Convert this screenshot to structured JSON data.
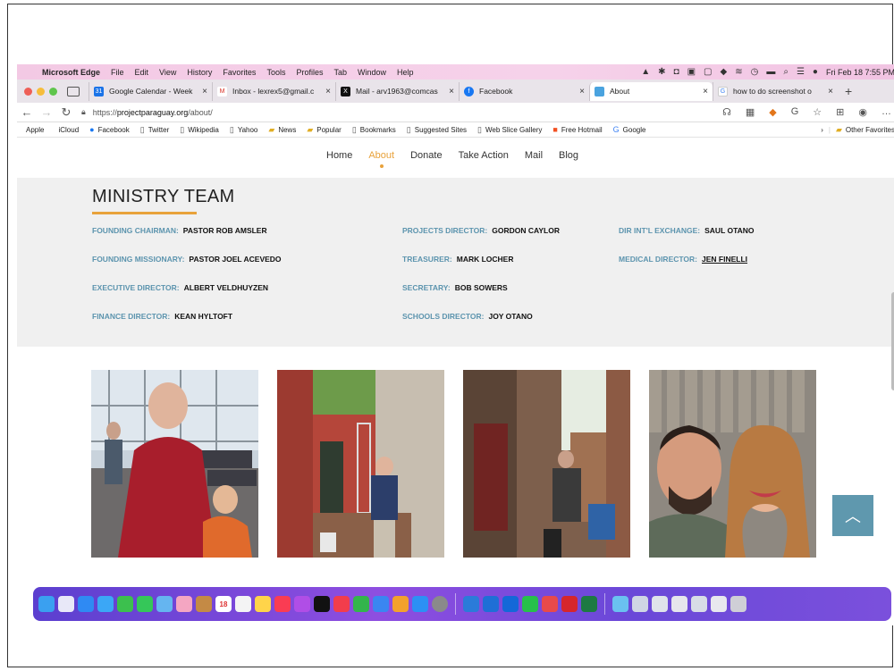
{
  "menubar": {
    "app_name": "Microsoft Edge",
    "items": [
      "File",
      "Edit",
      "View",
      "History",
      "Favorites",
      "Tools",
      "Profiles",
      "Tab",
      "Window",
      "Help"
    ],
    "datetime": "Fri Feb 18  7:55 PM"
  },
  "tabs": [
    {
      "title": "Google Calendar - Week",
      "favicon_color": "#1a73e8",
      "favicon": "31"
    },
    {
      "title": "Inbox - lexrex5@gmail.c",
      "favicon_color": "#d93025",
      "favicon": "M"
    },
    {
      "title": "Mail - arv1963@comcas",
      "favicon_color": "#111111",
      "favicon": "X"
    },
    {
      "title": "Facebook",
      "favicon_color": "#1877f2",
      "favicon": "f"
    },
    {
      "title": "About",
      "favicon_color": "#4aa3df",
      "favicon": "",
      "active": true
    },
    {
      "title": "how to do screenshot o",
      "favicon_color": "#ffffff",
      "favicon": "G"
    }
  ],
  "address": {
    "prefix": "https://",
    "domain": "projectparaguay.org",
    "path": "/about/"
  },
  "favorites": [
    {
      "label": "Apple",
      "icon": "apple-icon"
    },
    {
      "label": "iCloud",
      "icon": "apple-icon"
    },
    {
      "label": "Facebook",
      "icon": "facebook-icon"
    },
    {
      "label": "Twitter",
      "icon": "page-icon"
    },
    {
      "label": "Wikipedia",
      "icon": "page-icon"
    },
    {
      "label": "Yahoo",
      "icon": "page-icon"
    },
    {
      "label": "News",
      "icon": "folder-icon"
    },
    {
      "label": "Popular",
      "icon": "folder-icon"
    },
    {
      "label": "Bookmarks",
      "icon": "page-icon"
    },
    {
      "label": "Suggested Sites",
      "icon": "page-icon"
    },
    {
      "label": "Web Slice Gallery",
      "icon": "page-icon"
    },
    {
      "label": "Free Hotmail",
      "icon": "windows-icon"
    },
    {
      "label": "Google",
      "icon": "google-icon"
    }
  ],
  "other_favorites": "Other Favorites",
  "site_nav": [
    "Home",
    "About",
    "Donate",
    "Take Action",
    "Mail",
    "Blog"
  ],
  "team": {
    "heading": "MINISTRY TEAM",
    "members": [
      {
        "role": "FOUNDING CHAIRMAN:",
        "name": "PASTOR ROB AMSLER"
      },
      {
        "role": "FOUNDING MISSIONARY:",
        "name": "PASTOR JOEL ACEVEDO"
      },
      {
        "role": "EXECUTIVE DIRECTOR:",
        "name": "ALBERT VELDHUYZEN"
      },
      {
        "role": "FINANCE DIRECTOR:",
        "name": "KEAN HYLTOFT"
      },
      {
        "role": "PROJECTS DIRECTOR:",
        "name": "GORDON CAYLOR"
      },
      {
        "role": "TREASURER:",
        "name": "MARK LOCHER"
      },
      {
        "role": "SECRETARY:",
        "name": "BOB SOWERS"
      },
      {
        "role": "SCHOOLS DIRECTOR:",
        "name": "JOY OTANO"
      },
      {
        "role": "DIR INT'L EXCHANGE:",
        "name": "SAUL OTANO"
      },
      {
        "role": "MEDICAL DIRECTOR:",
        "name": "JEN FINELLI"
      }
    ]
  },
  "colors": {
    "accent": "#e8a23b",
    "role_text": "#5c94ae",
    "scroll_top_button": "#5f98ae"
  }
}
